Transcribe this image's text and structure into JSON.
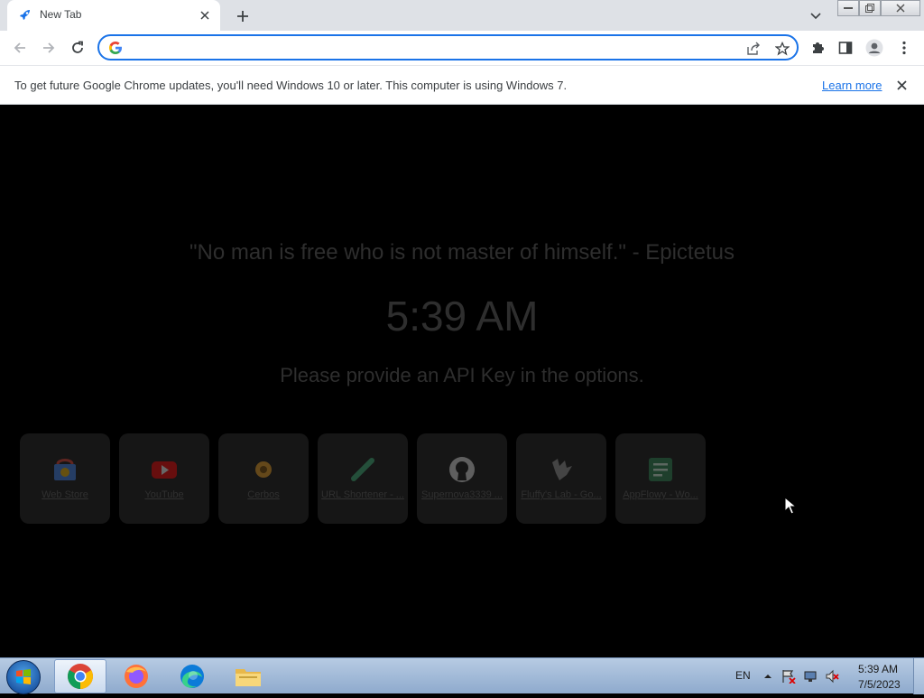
{
  "browser": {
    "tab_title": "New Tab",
    "omnibox_value": "",
    "omnibox_placeholder": ""
  },
  "infobar": {
    "message": "To get future Google Chrome updates, you'll need Windows 10 or later. This computer is using Windows 7.",
    "link_label": "Learn more"
  },
  "page": {
    "quote": "\"No man is free who is not master of himself.\" - Epictetus",
    "time": "5:39 AM",
    "api_message": "Please provide an API Key in the options."
  },
  "shortcuts": [
    {
      "label": "Web Store",
      "icon": "webstore-icon"
    },
    {
      "label": "YouTube",
      "icon": "youtube-icon"
    },
    {
      "label": "Cerbos",
      "icon": "cerbos-icon"
    },
    {
      "label": "URL Shortener - ...",
      "icon": "url-shortener-icon"
    },
    {
      "label": "Supernova3339 ...",
      "icon": "github-icon"
    },
    {
      "label": "Fluffy's Lab - Go...",
      "icon": "fluffys-lab-icon"
    },
    {
      "label": "AppFlowy - Wo...",
      "icon": "appflowy-icon"
    }
  ],
  "taskbar": {
    "language": "EN",
    "time": "5:39 AM",
    "date": "7/5/2023",
    "apps": [
      "chrome-icon",
      "firefox-icon",
      "edge-icon",
      "file-explorer-icon"
    ]
  },
  "colors": {
    "accent": "#1a73e8",
    "page_background": "#000000",
    "dim_text": "#2e2e2e"
  }
}
